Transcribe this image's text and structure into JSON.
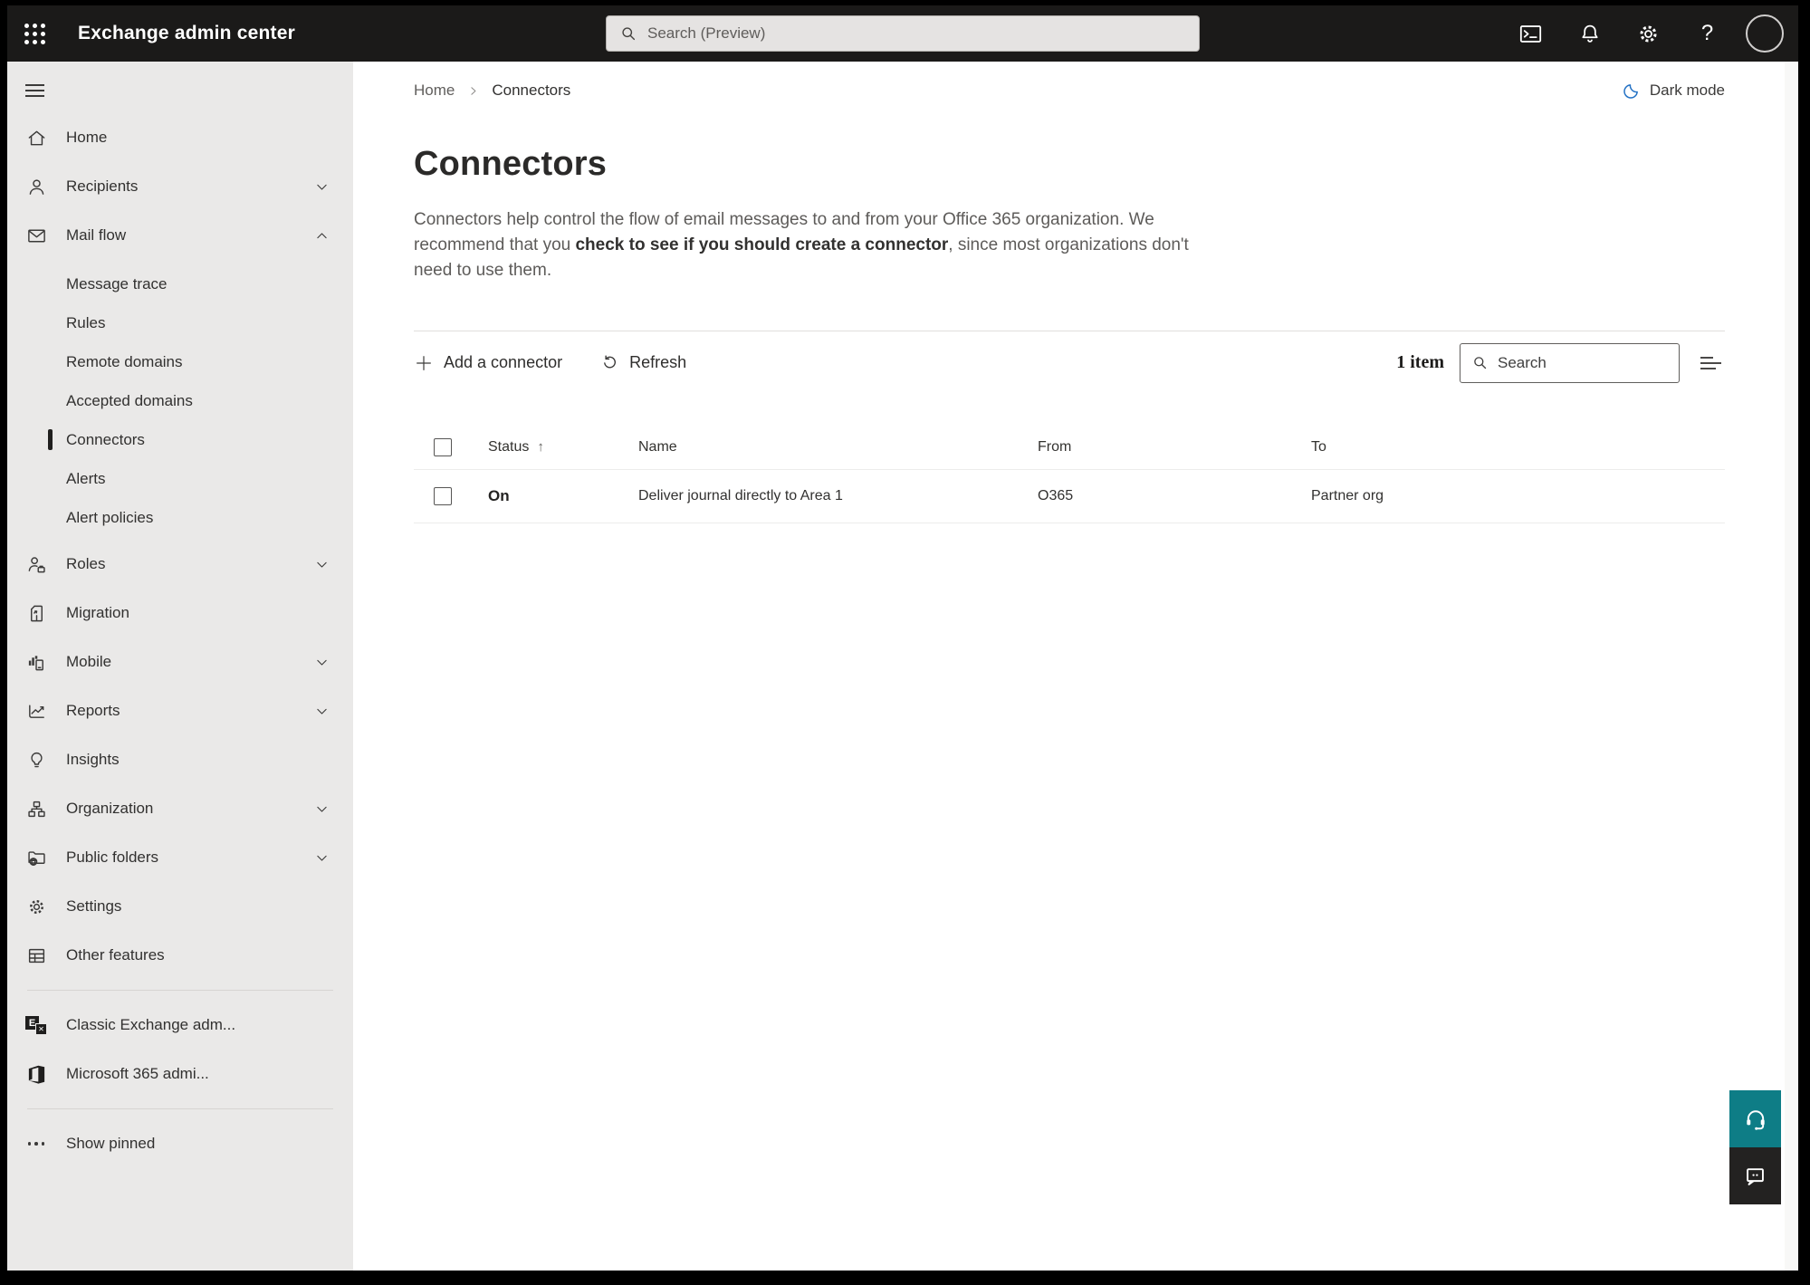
{
  "topbar": {
    "title": "Exchange admin center",
    "search_placeholder": "Search (Preview)",
    "help_glyph": "?"
  },
  "breadcrumb": {
    "home": "Home",
    "current": "Connectors"
  },
  "dark_mode": {
    "label": "Dark mode"
  },
  "page": {
    "title": "Connectors",
    "desc_pre": "Connectors help control the flow of email messages to and from your Office 365 organization. We recommend that you ",
    "desc_link": "check to see if you should create a connector",
    "desc_post": ", since most organizations don't need to use them."
  },
  "toolbar": {
    "add_label": "Add a connector",
    "refresh_label": "Refresh",
    "count_label": "1 item",
    "search_placeholder": "Search"
  },
  "table": {
    "col_status": "Status",
    "sort_arrow": "↑",
    "col_name": "Name",
    "col_from": "From",
    "col_to": "To",
    "rows": [
      {
        "status": "On",
        "name": "Deliver journal directly to Area 1",
        "from": "O365",
        "to": "Partner org"
      }
    ]
  },
  "sidebar": {
    "items": [
      {
        "label": "Home",
        "icon": "home-icon"
      },
      {
        "label": "Recipients",
        "icon": "person-icon",
        "expandable": true
      },
      {
        "label": "Mail flow",
        "icon": "mail-icon",
        "expandable": true,
        "expanded": true
      },
      {
        "label": "Roles",
        "icon": "person-briefcase-icon",
        "expandable": true
      },
      {
        "label": "Migration",
        "icon": "document-arrow-icon"
      },
      {
        "label": "Mobile",
        "icon": "chart-phone-icon",
        "expandable": true
      },
      {
        "label": "Reports",
        "icon": "line-chart-icon",
        "expandable": true
      },
      {
        "label": "Insights",
        "icon": "lightbulb-icon"
      },
      {
        "label": "Organization",
        "icon": "org-chart-icon",
        "expandable": true
      },
      {
        "label": "Public folders",
        "icon": "folder-globe-icon",
        "expandable": true
      },
      {
        "label": "Settings",
        "icon": "gear-icon"
      },
      {
        "label": "Other features",
        "icon": "table-icon"
      }
    ],
    "mail_flow_children": [
      {
        "label": "Message trace"
      },
      {
        "label": "Rules"
      },
      {
        "label": "Remote domains"
      },
      {
        "label": "Accepted domains"
      },
      {
        "label": "Connectors",
        "selected": true
      },
      {
        "label": "Alerts"
      },
      {
        "label": "Alert policies"
      }
    ],
    "footer_items": [
      {
        "label": "Classic Exchange adm...",
        "icon": "exchange-logo-icon",
        "logo_letter": "E",
        "logo_x": "✕"
      },
      {
        "label": "Microsoft 365 admi...",
        "icon": "m365-logo-icon"
      }
    ],
    "show_pinned_label": "Show pinned"
  },
  "icons": {
    "app_launcher": "waffle-grid",
    "cloud_shell": "terminal-window",
    "notifications": "bell",
    "settings": "gear",
    "help": "question-mark",
    "account": "avatar-circle",
    "dark_mode": "crescent-moon",
    "add": "plus",
    "refresh": "circular-arrow",
    "search": "magnifier",
    "filter": "lines",
    "support": "headset",
    "feedback": "chat-bubble"
  },
  "colors": {
    "topbar_bg": "#1b1a19",
    "sidebar_bg": "#eae9e8",
    "accent_teal": "#0e7d86",
    "dark_mode_icon_blue": "#2170c4",
    "selected_indicator": "#201f1e"
  }
}
